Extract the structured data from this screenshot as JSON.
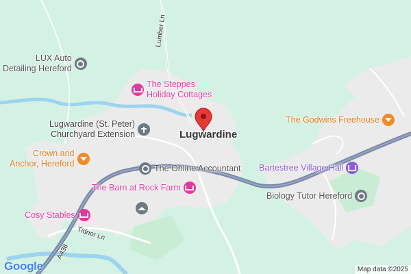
{
  "map": {
    "place": "Lugwardine",
    "colors": {
      "background": "#d4f2e4",
      "built_up": "#ebebeb",
      "water": "#9cd3ef",
      "main_road": "#7887a6",
      "minor_road": "#ffffff",
      "hotel": "#e5389f",
      "restaurant": "#f28a26",
      "venue": "#8c5bd6",
      "generic": "#6e7981",
      "pin": "#e53935"
    },
    "roads": {
      "lumber_ln": "Lumber Ln",
      "tidnor_ln": "Tidnor Ln",
      "a438": "A438"
    },
    "pois": {
      "lux": {
        "line1": "LUX Auto",
        "line2": "Detailing Hereford",
        "icon": "pin-generic-icon"
      },
      "steppes": {
        "line1": "The Steppes",
        "line2": "Holiday Cottages",
        "icon": "hotel-bed-icon"
      },
      "church": {
        "line1": "Lugwardine (St. Peter)",
        "line2": "Churchyard Extension",
        "icon": "cemetery-icon"
      },
      "crown": {
        "line1": "Crown and",
        "line2": "Anchor, Hereford",
        "icon": "cocktail-icon"
      },
      "accountant": {
        "line1": "The Online Accountant",
        "icon": "pin-generic-icon"
      },
      "barn": {
        "line1": "The Barn at Rock Farm",
        "icon": "hotel-bed-icon"
      },
      "cosy": {
        "line1": "Cosy Stables",
        "icon": "hotel-bed-icon"
      },
      "school": {
        "icon": "school-cap-icon"
      },
      "godwins": {
        "line1": "The Godwins Freehouse",
        "icon": "cocktail-icon"
      },
      "bartestree": {
        "line1": "Bartestree Village Hall",
        "icon": "venue-icon"
      },
      "biology": {
        "line1": "Biology Tutor Hereford",
        "icon": "pin-generic-icon"
      }
    },
    "logo": "Google",
    "attribution": "Map data ©2025"
  }
}
